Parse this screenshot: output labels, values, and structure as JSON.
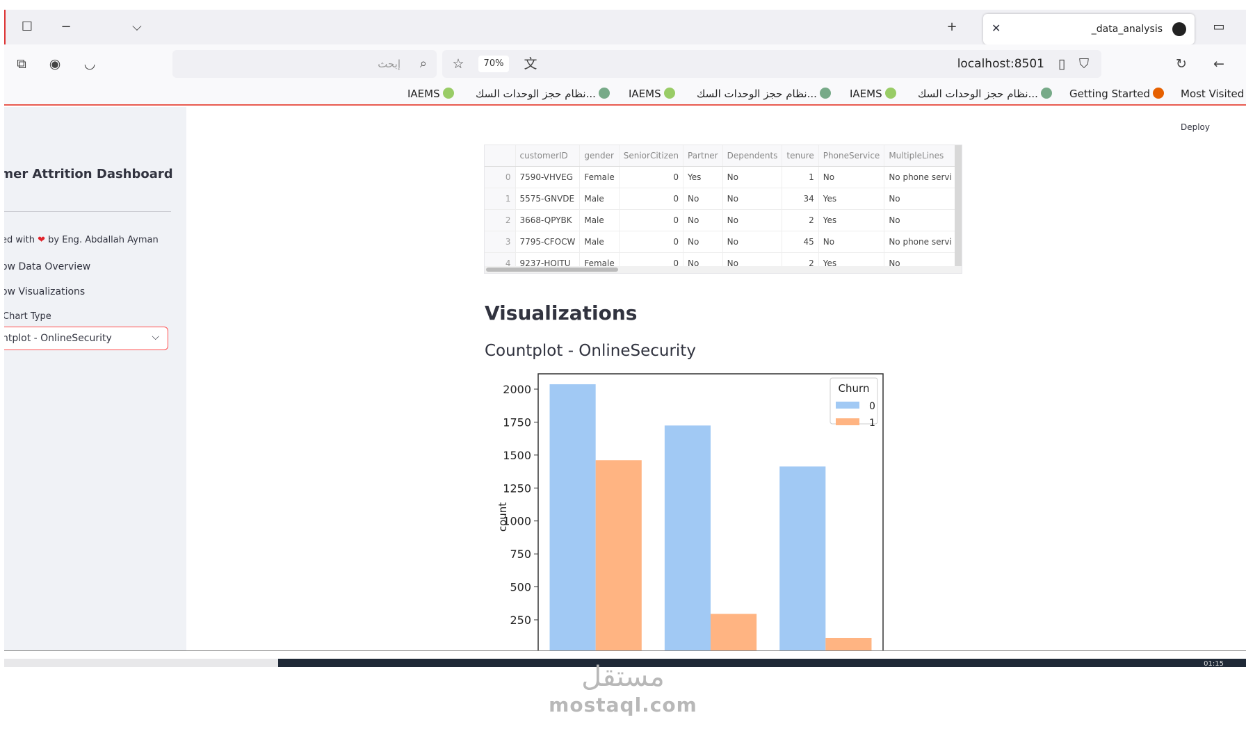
{
  "browser": {
    "tab_title": "_data_analysis",
    "search_placeholder": "إبحث",
    "url": "localhost:8501",
    "zoom": "70%",
    "bookmarks": [
      "Most Visited",
      "Getting Started",
      "نظام حجز الوحدات السك...",
      "IAEMS",
      "نظام حجز الوحدات السك...",
      "IAEMS",
      "نظام حجز الوحدات السك...",
      "IAEMS"
    ]
  },
  "sidebar": {
    "title": "omer Attrition Dashboard",
    "credit_prefix": "ed with",
    "credit_suffix": "by Eng. Abdallah Ayman",
    "check_overview": "ow Data Overview",
    "check_visualizations": "ow Visualizations",
    "chart_type_label": "Chart Type",
    "chart_type_value": "ntplot - OnlineSecurity"
  },
  "main": {
    "deploy_label": "Deploy",
    "table": {
      "columns": [
        "",
        "customerID",
        "gender",
        "SeniorCitizen",
        "Partner",
        "Dependents",
        "tenure",
        "PhoneService",
        "MultipleLines"
      ],
      "rows": [
        [
          "0",
          "7590-VHVEG",
          "Female",
          "0",
          "Yes",
          "No",
          "1",
          "No",
          "No phone servi"
        ],
        [
          "1",
          "5575-GNVDE",
          "Male",
          "0",
          "No",
          "No",
          "34",
          "Yes",
          "No"
        ],
        [
          "2",
          "3668-QPYBK",
          "Male",
          "0",
          "No",
          "No",
          "2",
          "Yes",
          "No"
        ],
        [
          "3",
          "7795-CFOCW",
          "Male",
          "0",
          "No",
          "No",
          "45",
          "No",
          "No phone servi"
        ],
        [
          "4",
          "9237-HQITU",
          "Female",
          "0",
          "No",
          "No",
          "2",
          "Yes",
          "No"
        ]
      ]
    },
    "visualizations_heading": "Visualizations",
    "countplot_heading": "Countplot - OnlineSecurity"
  },
  "chart_data": {
    "type": "bar",
    "title": "",
    "xlabel": "",
    "ylabel": "count",
    "ylim": [
      0,
      2100
    ],
    "yticks": [
      250,
      500,
      750,
      1000,
      1250,
      1500,
      1750,
      2000
    ],
    "categories": [
      "",
      "",
      ""
    ],
    "legend_title": "Churn",
    "legend_position": "top-right",
    "series": [
      {
        "name": "0",
        "color": "#a1c9f4",
        "values": [
          2037,
          1724,
          1413
        ]
      },
      {
        "name": "1",
        "color": "#ffb482",
        "values": [
          1461,
          295,
          113
        ]
      }
    ]
  },
  "taskbar": {
    "clock": "01:15"
  },
  "watermark": {
    "arabic": "مستقل",
    "latin": "mostaql.com"
  }
}
